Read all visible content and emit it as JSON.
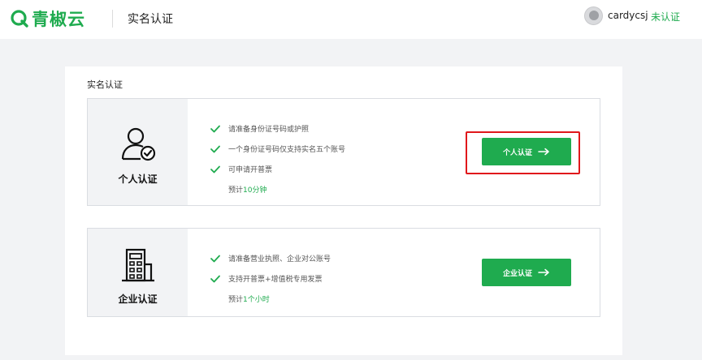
{
  "header": {
    "logo_text": "青椒云",
    "page_title": "实名认证",
    "username": "cardycsj",
    "status_link": "未认证"
  },
  "panel": {
    "title": "实名认证",
    "personal": {
      "label": "个人认证",
      "requirements": [
        "请准备身份证号码或护照",
        "一个身份证号码仅支持实名五个账号",
        "可申请开普票"
      ],
      "estimate_prefix": "预计",
      "estimate_value": "10分钟",
      "button_label": "个人认证"
    },
    "enterprise": {
      "label": "企业认证",
      "requirements": [
        "请准备营业执照、企业对公账号",
        "支持开普票+增值税专用发票"
      ],
      "estimate_prefix": "预计",
      "estimate_value": "1个小时",
      "button_label": "企业认证"
    }
  },
  "colors": {
    "brand_green": "#1fab4f",
    "highlight_red": "#e0171b",
    "background": "#f2f3f5"
  },
  "icons": {
    "logo": "q-logo-icon",
    "personal": "user-verified-icon",
    "enterprise": "building-icon",
    "check": "check-icon",
    "arrow": "arrow-right-icon"
  }
}
